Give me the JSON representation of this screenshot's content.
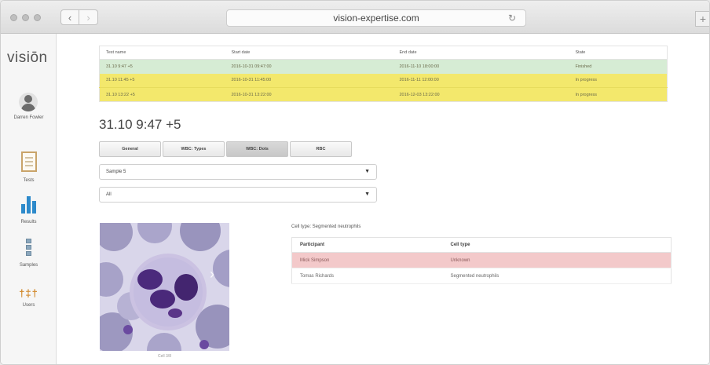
{
  "browser": {
    "address": "vision-expertise.com",
    "back_glyph": "‹",
    "forward_glyph": "›",
    "reload_glyph": "↻",
    "newtab_glyph": "+"
  },
  "sidebar": {
    "logo": "visiōn",
    "user_name": "Darren Fowler",
    "items": [
      {
        "label": "Tests",
        "icon": "document-icon"
      },
      {
        "label": "Results",
        "icon": "bar-chart-icon"
      },
      {
        "label": "Samples",
        "icon": "samples-icon"
      },
      {
        "label": "Users",
        "icon": "users-icon"
      }
    ],
    "users_glyph": "†‡†"
  },
  "tests_table": {
    "headers": [
      "Test name",
      "Start date",
      "End date",
      "State"
    ],
    "rows": [
      {
        "name": "31.10 9:47 +5",
        "start": "2016-10-31 09:47:00",
        "end": "2016-11-10 18:00:00",
        "state": "Finished",
        "color": "#d6ecd4"
      },
      {
        "name": "31.10 11:45 +5",
        "start": "2016-10-31 11:45:00",
        "end": "2016-11-11 12:00:00",
        "state": "In progress",
        "color": "#f3e86c"
      },
      {
        "name": "31.10 13:22 +5",
        "start": "2016-10-31 13:22:00",
        "end": "2016-12-03 13:22:00",
        "state": "In progress",
        "color": "#f3e86c"
      }
    ]
  },
  "test_title": "31.10 9:47 +5",
  "tabs": [
    {
      "label": "General",
      "active": false
    },
    {
      "label": "WBC: Types",
      "active": false
    },
    {
      "label": "WBC: Dots",
      "active": true
    },
    {
      "label": "RBC",
      "active": false
    }
  ],
  "sample_select": {
    "value": "Sample 5"
  },
  "filter_select": {
    "value": "All"
  },
  "image": {
    "caption": "Cell 3/8",
    "next_glyph": "›"
  },
  "cell_type_label": "Cell type: Segmented neutrophils",
  "participants_table": {
    "headers": [
      "Participant",
      "Cell type"
    ],
    "rows": [
      {
        "participant": "Mick Simpson",
        "cell_type": "Unknown",
        "color": "#f3c9ca"
      },
      {
        "participant": "Tomas Richards",
        "cell_type": "Segmented neutrophils",
        "color": "#ffffff"
      }
    ]
  }
}
